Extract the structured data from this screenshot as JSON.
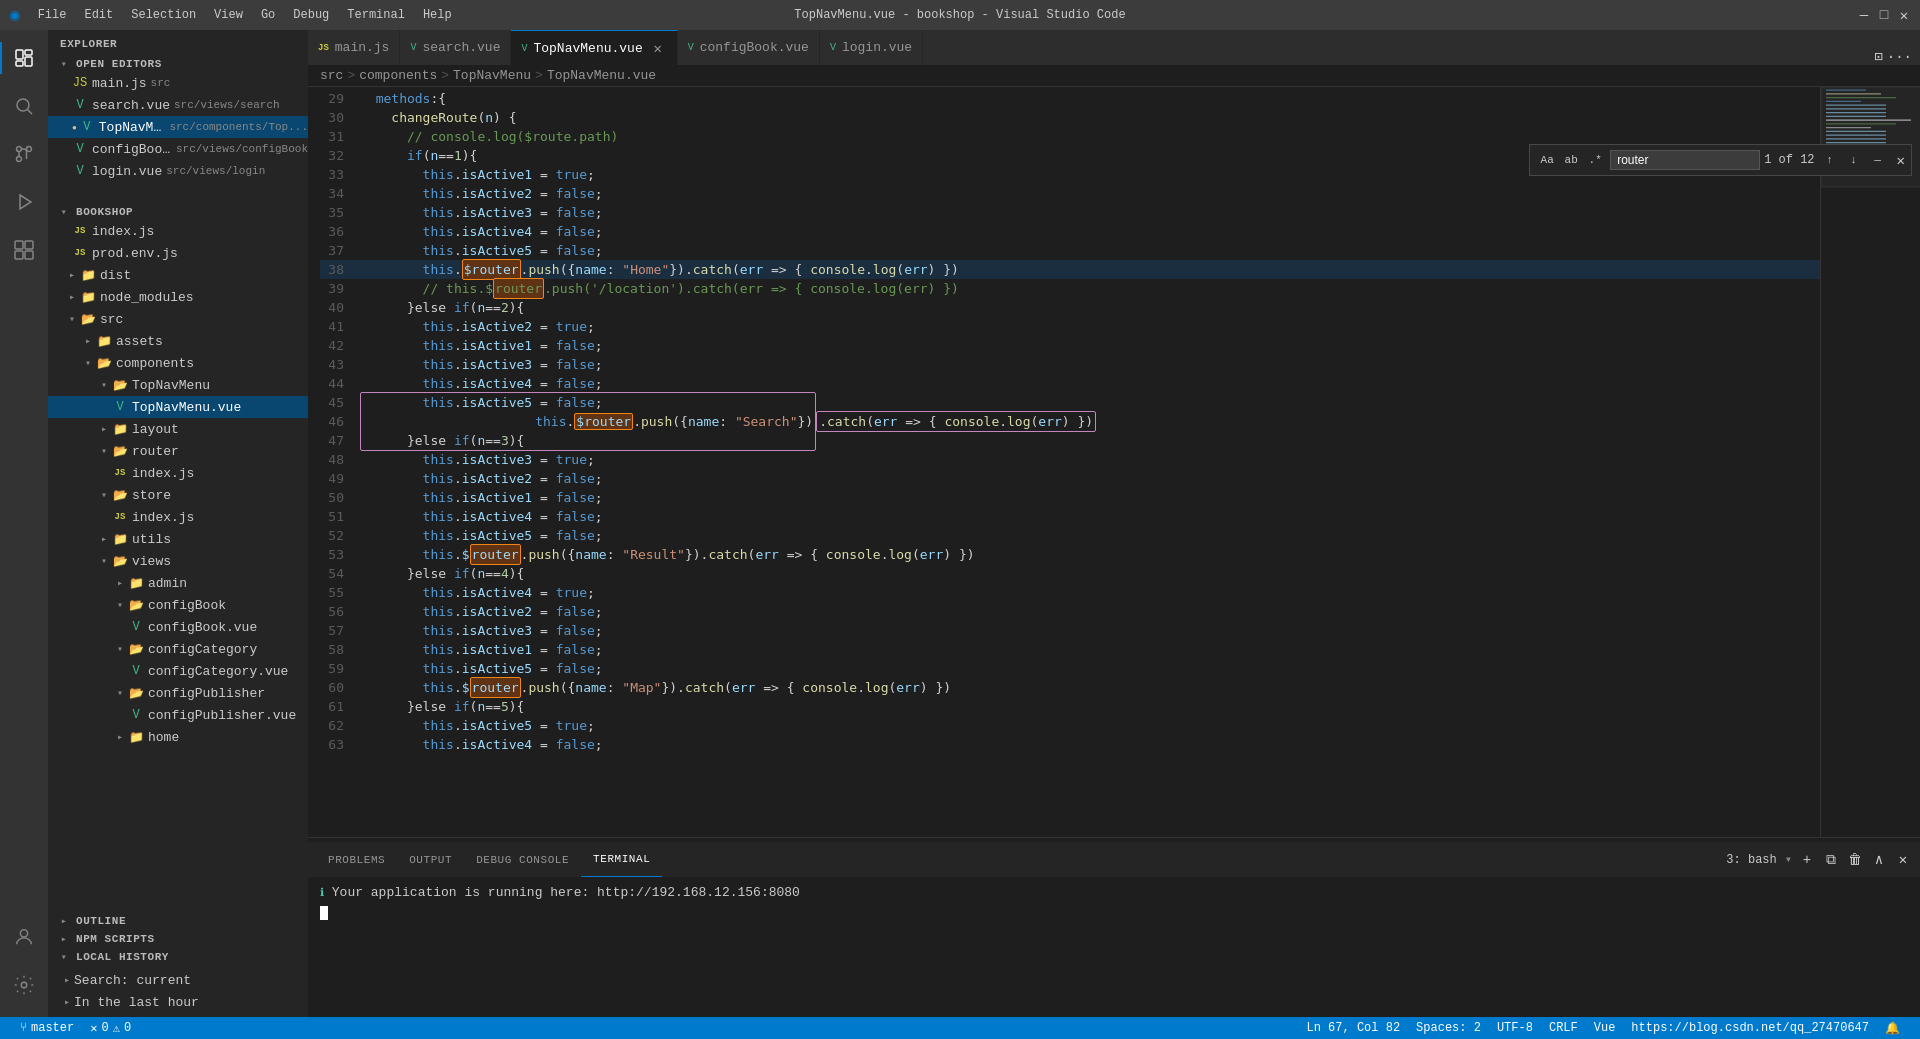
{
  "titleBar": {
    "title": "TopNavMenu.vue - bookshop - Visual Studio Code",
    "menu": [
      "File",
      "Edit",
      "Selection",
      "View",
      "Go",
      "Debug",
      "Terminal",
      "Help"
    ],
    "windowControls": [
      "—",
      "□",
      "✕"
    ]
  },
  "activityBar": {
    "icons": [
      {
        "name": "explorer-icon",
        "symbol": "⎘",
        "active": true
      },
      {
        "name": "search-icon",
        "symbol": "🔍",
        "active": false
      },
      {
        "name": "source-control-icon",
        "symbol": "⑂",
        "active": false
      },
      {
        "name": "debug-icon",
        "symbol": "▷",
        "active": false
      },
      {
        "name": "extensions-icon",
        "symbol": "⊞",
        "active": false
      }
    ],
    "bottomIcons": [
      {
        "name": "account-icon",
        "symbol": "👤"
      },
      {
        "name": "settings-icon",
        "symbol": "⚙"
      }
    ]
  },
  "sidebar": {
    "explorerTitle": "EXPLORER",
    "sections": {
      "openEditors": {
        "label": "OPEN EDITORS",
        "items": [
          {
            "name": "main.js",
            "type": "js",
            "path": "src",
            "modified": false
          },
          {
            "name": "search.vue",
            "type": "vue",
            "path": "src/views/search",
            "modified": false
          },
          {
            "name": "TopNavMenu.vue",
            "type": "vue",
            "path": "src/components/Top...",
            "modified": true
          },
          {
            "name": "configBook.vue",
            "type": "vue",
            "path": "src/views/configBook",
            "modified": false
          },
          {
            "name": "login.vue",
            "type": "vue",
            "path": "src/views/login",
            "modified": false
          }
        ]
      },
      "bookshop": {
        "label": "BOOKSHOP",
        "items": [
          {
            "name": "index.js",
            "type": "js",
            "indent": 1
          },
          {
            "name": "prod.env.js",
            "type": "js",
            "indent": 1
          },
          {
            "name": "dist",
            "type": "folder",
            "indent": 1
          },
          {
            "name": "node_modules",
            "type": "folder",
            "indent": 1
          },
          {
            "name": "src",
            "type": "folder",
            "indent": 1,
            "open": true
          },
          {
            "name": "assets",
            "type": "folder",
            "indent": 2
          },
          {
            "name": "components",
            "type": "folder",
            "indent": 2,
            "open": true
          },
          {
            "name": "TopNavMenu",
            "type": "folder",
            "indent": 3,
            "open": true
          },
          {
            "name": "TopNavMenu.vue",
            "type": "vue",
            "indent": 4,
            "active": true
          },
          {
            "name": "layout",
            "type": "folder",
            "indent": 3
          },
          {
            "name": "router",
            "type": "folder",
            "indent": 3
          },
          {
            "name": "index.js",
            "type": "js",
            "indent": 4
          },
          {
            "name": "store",
            "type": "folder",
            "indent": 3
          },
          {
            "name": "index.js",
            "type": "js",
            "indent": 4
          },
          {
            "name": "utils",
            "type": "folder",
            "indent": 3
          },
          {
            "name": "views",
            "type": "folder",
            "indent": 3,
            "open": true
          },
          {
            "name": "admin",
            "type": "folder",
            "indent": 4
          },
          {
            "name": "configBook",
            "type": "folder",
            "indent": 4,
            "open": true
          },
          {
            "name": "configBook.vue",
            "type": "vue",
            "indent": 5
          },
          {
            "name": "configCategory",
            "type": "folder",
            "indent": 4,
            "open": true
          },
          {
            "name": "configCategory.vue",
            "type": "vue",
            "indent": 5
          },
          {
            "name": "configPublisher",
            "type": "folder",
            "indent": 4,
            "open": true
          },
          {
            "name": "configPublisher.vue",
            "type": "vue",
            "indent": 5
          },
          {
            "name": "home",
            "type": "folder",
            "indent": 4
          }
        ]
      },
      "outline": {
        "label": "OUTLINE",
        "collapsed": true
      },
      "npmScripts": {
        "label": "NPM SCRIPTS",
        "collapsed": true
      },
      "localHistory": {
        "label": "LOCAL HISTORY",
        "items": [
          {
            "label": "Search: current",
            "expanded": false
          },
          {
            "label": "In the last hour",
            "expanded": false
          }
        ]
      }
    }
  },
  "tabs": [
    {
      "label": "main.js",
      "type": "js",
      "active": false,
      "modified": false,
      "closeable": false
    },
    {
      "label": "search.vue",
      "type": "vue",
      "active": false,
      "modified": false,
      "closeable": false
    },
    {
      "label": "TopNavMenu.vue",
      "type": "vue",
      "active": true,
      "modified": true,
      "closeable": true
    },
    {
      "label": "configBook.vue",
      "type": "vue",
      "active": false,
      "modified": false,
      "closeable": false
    },
    {
      "label": "login.vue",
      "type": "vue",
      "active": false,
      "modified": false,
      "closeable": false
    }
  ],
  "breadcrumb": {
    "parts": [
      "src",
      "components",
      "TopNavMenu",
      "TopNavMenu.vue"
    ]
  },
  "searchWidget": {
    "query": "router",
    "matchCount": "1 of 12",
    "placeholder": "Find",
    "matchCase": false,
    "matchWord": false,
    "useRegex": false
  },
  "code": {
    "startLine": 29,
    "lines": [
      {
        "n": 29,
        "text": "  methods:{"
      },
      {
        "n": 30,
        "text": "    changeRoute(n) {"
      },
      {
        "n": 31,
        "text": "      // console.log($route.path)"
      },
      {
        "n": 32,
        "text": "      if(n==1){"
      },
      {
        "n": 33,
        "text": "        this.isActive1 = true;"
      },
      {
        "n": 34,
        "text": "        this.isActive2 = false;"
      },
      {
        "n": 35,
        "text": "        this.isActive3 = false;"
      },
      {
        "n": 36,
        "text": "        this.isActive4 = false;"
      },
      {
        "n": 37,
        "text": "        this.isActive5 = false;"
      },
      {
        "n": 38,
        "text": "        this.$router.push({name: \"Home\"}).catch(err => { console.log(err) })",
        "highlight": "current"
      },
      {
        "n": 39,
        "text": "        // this.$router.push('/location').catch(err => { console.log(err) })"
      },
      {
        "n": 40,
        "text": "      }else if(n==2){"
      },
      {
        "n": 41,
        "text": "        this.isActive2 = true;"
      },
      {
        "n": 42,
        "text": "        this.isActive1 = false;"
      },
      {
        "n": 43,
        "text": "        this.isActive3 = false;"
      },
      {
        "n": 44,
        "text": "        this.isActive4 = false;"
      },
      {
        "n": 45,
        "text": "        this.isActive5 = false;"
      },
      {
        "n": 46,
        "text": "        this.$router.push({name: \"Search\"}).catch(err => { console.log(err) })",
        "highlight": "normal"
      },
      {
        "n": 47,
        "text": "      }else if(n==3){"
      },
      {
        "n": 48,
        "text": "        this.isActive3 = true;"
      },
      {
        "n": 49,
        "text": "        this.isActive2 = false;"
      },
      {
        "n": 50,
        "text": "        this.isActive1 = false;"
      },
      {
        "n": 51,
        "text": "        this.isActive4 = false;"
      },
      {
        "n": 52,
        "text": "        this.isActive5 = false;"
      },
      {
        "n": 53,
        "text": "        this.$router.push({name: \"Result\"}).catch(err => { console.log(err) })"
      },
      {
        "n": 54,
        "text": "      }else if(n==4){"
      },
      {
        "n": 55,
        "text": "        this.isActive4 = true;"
      },
      {
        "n": 56,
        "text": "        this.isActive2 = false;"
      },
      {
        "n": 57,
        "text": "        this.isActive3 = false;"
      },
      {
        "n": 58,
        "text": "        this.isActive1 = false;"
      },
      {
        "n": 59,
        "text": "        this.isActive5 = false;"
      },
      {
        "n": 60,
        "text": "        this.$router.push({name: \"Map\"}).catch(err => { console.log(err) })"
      },
      {
        "n": 61,
        "text": "      }else if(n==5){"
      },
      {
        "n": 62,
        "text": "        this.isActive5 = true;"
      },
      {
        "n": 63,
        "text": "        this.isActive4 = false;"
      }
    ]
  },
  "terminal": {
    "tabs": [
      "PROBLEMS",
      "OUTPUT",
      "DEBUG CONSOLE",
      "TERMINAL"
    ],
    "activeTab": "TERMINAL",
    "bashLabel": "3: bash",
    "content": "Your application is running here: http://192.168.12.156:8080"
  },
  "statusBar": {
    "branch": "master",
    "errors": "0",
    "warnings": "0",
    "line": "Ln 67",
    "col": "Col 82",
    "encoding": "UTF-8",
    "lineEnding": "CRLF",
    "language": "Vue",
    "spaces": "Spaces: 2",
    "link": "https://blog.csdn.net/qq_27470647"
  }
}
